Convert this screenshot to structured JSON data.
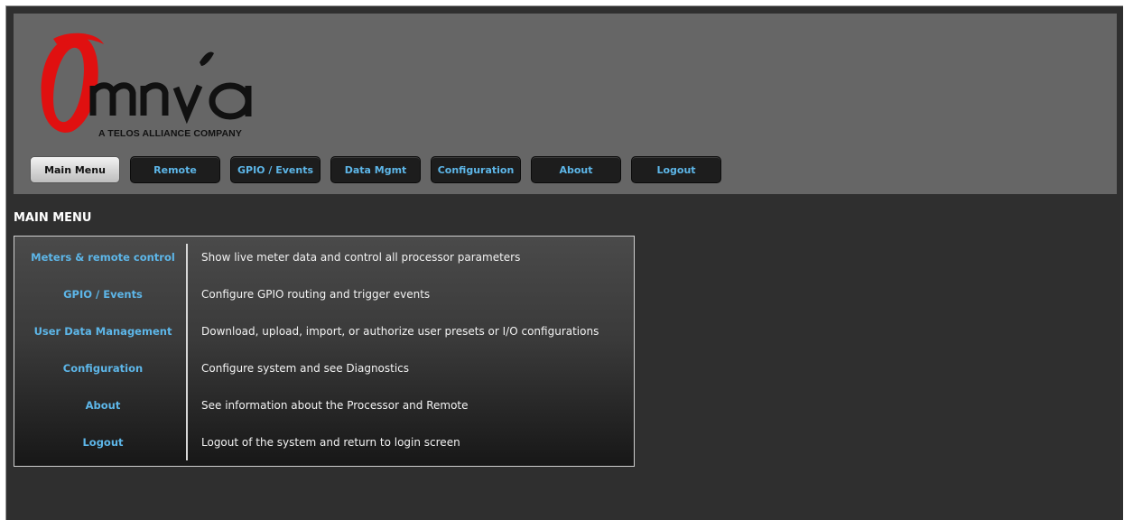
{
  "logo": {
    "icon": "omnia-logo",
    "tagline": "A TELOS ALLIANCE COMPANY",
    "colors": {
      "swoosh": "#e01010",
      "wordmark": "#111111"
    }
  },
  "nav": {
    "items": [
      {
        "label": "Main Menu",
        "active": true
      },
      {
        "label": "Remote"
      },
      {
        "label": "GPIO / Events"
      },
      {
        "label": "Data Mgmt"
      },
      {
        "label": "Configuration"
      },
      {
        "label": "About"
      },
      {
        "label": "Logout"
      }
    ]
  },
  "page": {
    "title": "MAIN MENU"
  },
  "menu": {
    "items": [
      {
        "link": "Meters & remote control",
        "description": "Show live meter data and control all processor parameters"
      },
      {
        "link": "GPIO / Events",
        "description": "Configure GPIO routing and trigger events"
      },
      {
        "link": "User Data Management",
        "description": "Download, upload, import, or authorize user presets or I/O configurations"
      },
      {
        "link": "Configuration",
        "description": "Configure system and see Diagnostics"
      },
      {
        "link": "About",
        "description": "See information about the Processor and Remote"
      },
      {
        "link": "Logout",
        "description": "Logout of the system and return to login screen"
      }
    ]
  },
  "colors": {
    "link": "#5db6e8",
    "header_bg": "#666666",
    "page_bg": "#2f2f2f",
    "active_tab": "#d9d9d9"
  }
}
